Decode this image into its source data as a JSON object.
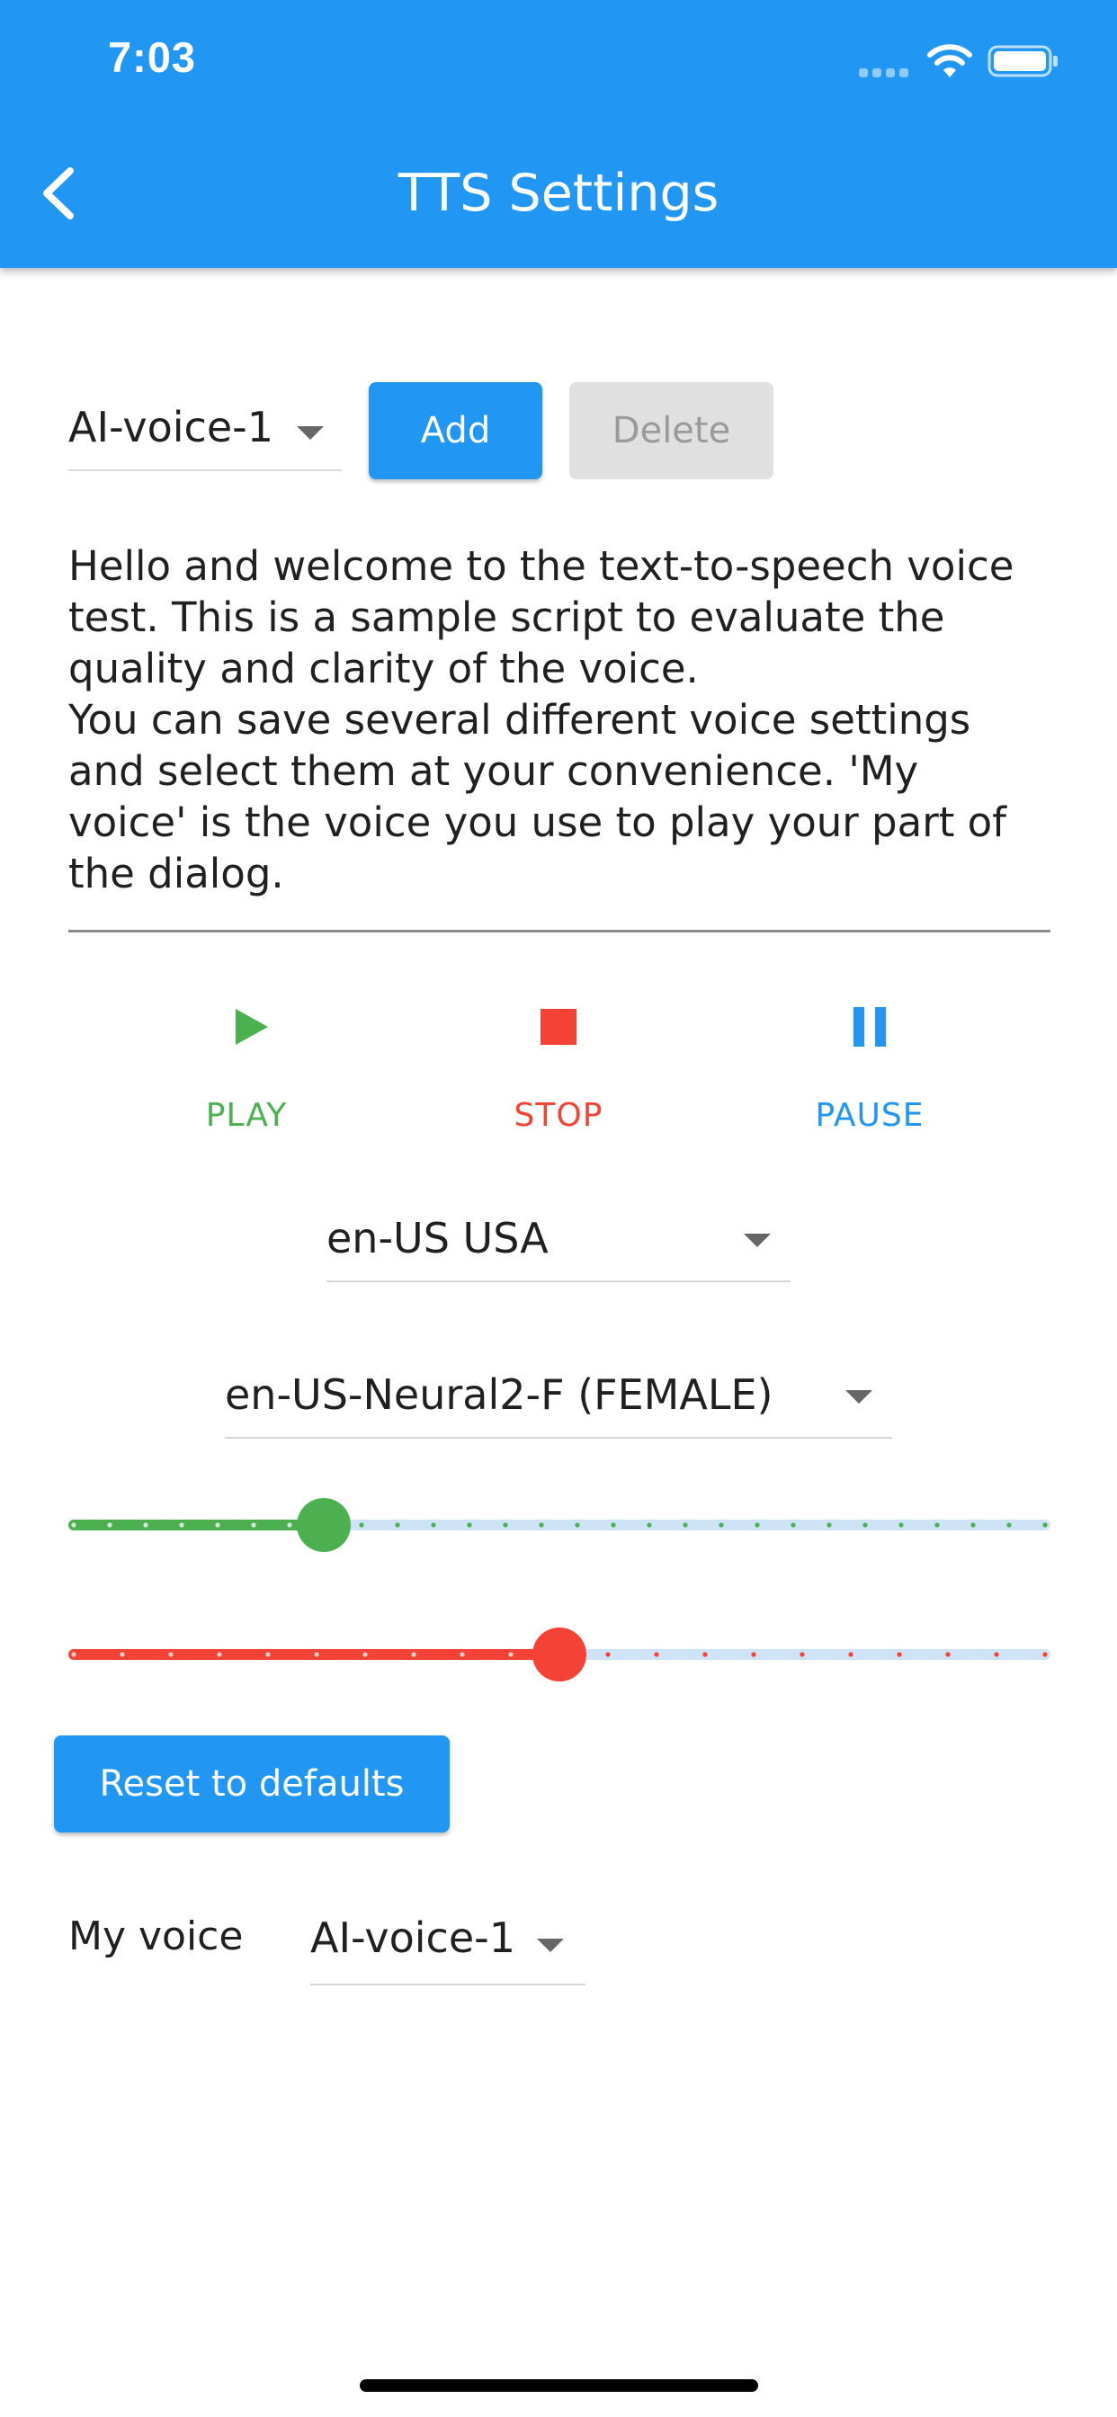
{
  "status_bar": {
    "time": "7:03"
  },
  "app_bar": {
    "title": "TTS Settings",
    "back_icon": "chevron-left-icon",
    "color": "#2196F3"
  },
  "voice_select": {
    "value": "AI-voice-1"
  },
  "buttons": {
    "add": "Add",
    "delete": "Delete",
    "reset": "Reset to defaults"
  },
  "sample_text": "Hello and welcome to the text-to-speech voice\ntest. This is a sample script to evaluate the\nquality and clarity of the voice.\nYou can save several different voice settings\nand select them at your convenience. 'My\nvoice' is the voice you use to play your part of\nthe dialog.",
  "controls": {
    "play": {
      "label": "PLAY",
      "color": "#4CAF50",
      "icon": "play-icon"
    },
    "stop": {
      "label": "STOP",
      "color": "#F44336",
      "icon": "stop-icon"
    },
    "pause": {
      "label": "PAUSE",
      "color": "#2196F3",
      "icon": "pause-icon"
    }
  },
  "language_select": {
    "value": "en-US USA"
  },
  "voice_name_select": {
    "value": "en-US-Neural2-F (FEMALE)"
  },
  "sliders": [
    {
      "name": "speed-slider",
      "value": 0.26,
      "color": "#4CAF50",
      "divisions": 27
    },
    {
      "name": "pitch-slider",
      "value": 0.5,
      "color": "#F44336",
      "divisions": 20
    }
  ],
  "my_voice": {
    "label": "My voice",
    "value": "AI-voice-1"
  }
}
